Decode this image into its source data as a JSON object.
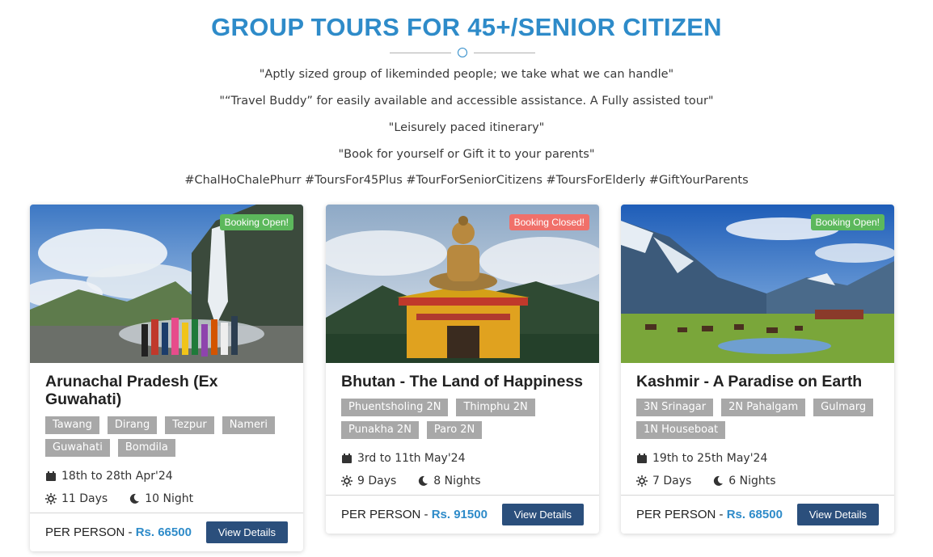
{
  "header": {
    "title": "GROUP TOURS FOR 45+/SENIOR CITIZEN",
    "taglines": [
      "\"Aptly sized group of likeminded people; we take what we can handle\"",
      "\"“Travel Buddy” for easily available and accessible assistance. A Fully assisted tour\"",
      "\"Leisurely paced itinerary\"",
      "\"Book for yourself or Gift it to your parents\"",
      "#ChalHoChalePhurr #ToursFor45Plus #TourForSeniorCitizens #ToursForElderly #GiftYourParents"
    ]
  },
  "accent_color": "#2e8bc9",
  "cards": [
    {
      "badge": "Booking Open!",
      "badge_color": "#5cb85c",
      "title": "Arunachal Pradesh (Ex Guwahati)",
      "tags": [
        "Tawang",
        "Dirang",
        "Tezpur",
        "Nameri",
        "Guwahati",
        "Bomdila"
      ],
      "dates": "18th to 28th Apr'24",
      "days": "11 Days",
      "nights": "10 Night",
      "price_label": "PER PERSON - ",
      "price": "Rs. 66500",
      "button": "View Details"
    },
    {
      "badge": "Booking Closed!",
      "badge_color": "#f0706a",
      "title": "Bhutan - The Land of Happiness",
      "tags": [
        "Phuentsholing 2N",
        "Thimphu 2N",
        "Punakha 2N",
        "Paro 2N"
      ],
      "dates": "3rd to 11th May'24",
      "days": "9 Days",
      "nights": "8 Nights",
      "price_label": "PER PERSON - ",
      "price": "Rs. 91500",
      "button": "View Details"
    },
    {
      "badge": "Booking Open!",
      "badge_color": "#5cb85c",
      "title": "Kashmir - A Paradise on Earth",
      "tags": [
        "3N Srinagar",
        "2N Pahalgam",
        "Gulmarg",
        "1N Houseboat"
      ],
      "dates": "19th to 25th May'24",
      "days": "7 Days",
      "nights": "6 Nights",
      "price_label": "PER PERSON - ",
      "price": "Rs. 68500",
      "button": "View Details"
    }
  ]
}
